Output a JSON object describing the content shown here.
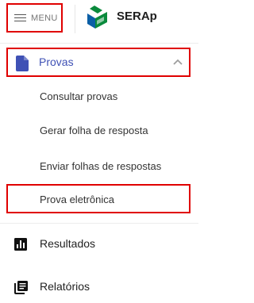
{
  "header": {
    "menu_label": "MENU",
    "brand": "SERAp",
    "logo_colors": [
      "#0a8a3c",
      "#0b5fa6"
    ]
  },
  "sidebar": {
    "section": {
      "label": "Provas",
      "icon": "document-icon",
      "expanded": true,
      "accent_color": "#3f51b5",
      "items": [
        {
          "label": "Consultar provas"
        },
        {
          "label": "Gerar folha de resposta"
        },
        {
          "label": "Enviar folhas de respostas"
        },
        {
          "label": "Prova eletrônica"
        }
      ]
    },
    "items": [
      {
        "label": "Resultados",
        "icon": "bar-chart-icon"
      },
      {
        "label": "Relatórios",
        "icon": "library-books-icon"
      }
    ]
  },
  "highlight_color": "#e00000"
}
